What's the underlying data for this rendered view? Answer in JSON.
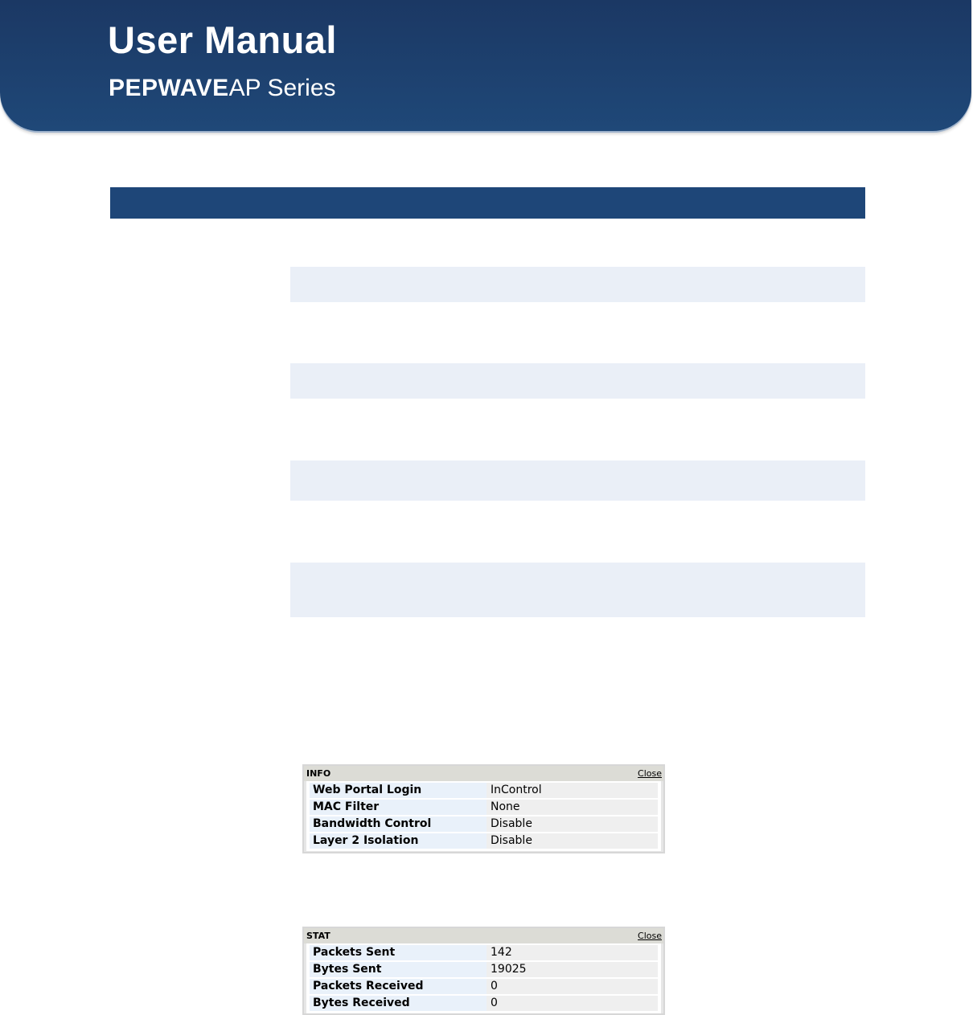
{
  "header": {
    "title": "User Manual",
    "brand": "PEPWAVE",
    "series": "AP Series"
  },
  "info_panel": {
    "title": "INFO",
    "close_label": "Close",
    "rows": [
      {
        "label": "Web Portal Login",
        "value": "InControl"
      },
      {
        "label": "MAC Filter",
        "value": "None"
      },
      {
        "label": "Bandwidth Control",
        "value": "Disable"
      },
      {
        "label": "Layer 2 Isolation",
        "value": "Disable"
      }
    ]
  },
  "stat_panel": {
    "title": "STAT",
    "close_label": "Close",
    "rows": [
      {
        "label": "Packets Sent",
        "value": "142"
      },
      {
        "label": "Bytes Sent",
        "value": "19025"
      },
      {
        "label": "Packets Received",
        "value": "0"
      },
      {
        "label": "Bytes Received",
        "value": "0"
      }
    ]
  },
  "colors": {
    "banner": "#1f4878",
    "table_header": "#1e4678",
    "row_stripe": "#eaeff7"
  }
}
